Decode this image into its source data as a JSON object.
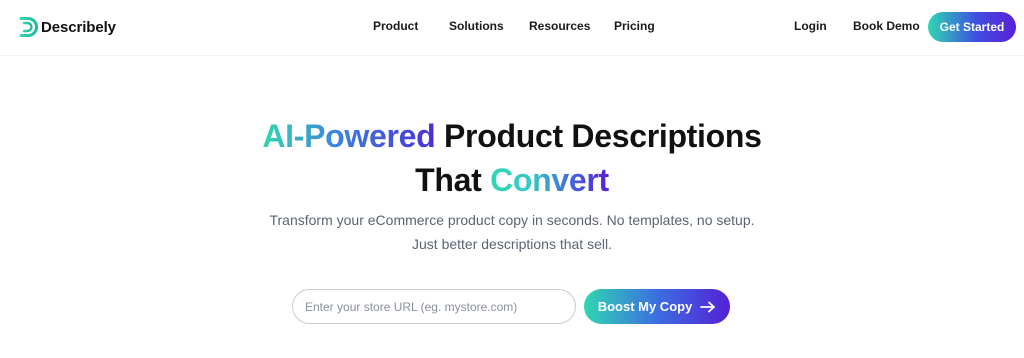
{
  "header": {
    "brand": "Describely",
    "nav": [
      "Product",
      "Solutions",
      "Resources",
      "Pricing"
    ],
    "login": "Login",
    "book_demo": "Book Demo",
    "get_started": "Get Started"
  },
  "hero": {
    "headline_part1": "AI-Powered",
    "headline_part2": " Product Descriptions",
    "headline_part3": "That ",
    "headline_part4": "Convert",
    "subtitle_line1": "Transform your eCommerce product copy in seconds. No templates, no setup.",
    "subtitle_line2": "Just better descriptions that sell."
  },
  "form": {
    "url_placeholder": "Enter your store URL (eg. mystore.com)",
    "url_value": "",
    "submit_label": "Boost My Copy",
    "submit_icon": "arrow-right-icon"
  },
  "colors": {
    "brand_teal": "#2fd6b2",
    "brand_purple": "#5420d6",
    "text": "#111111",
    "muted": "#5b6472"
  }
}
